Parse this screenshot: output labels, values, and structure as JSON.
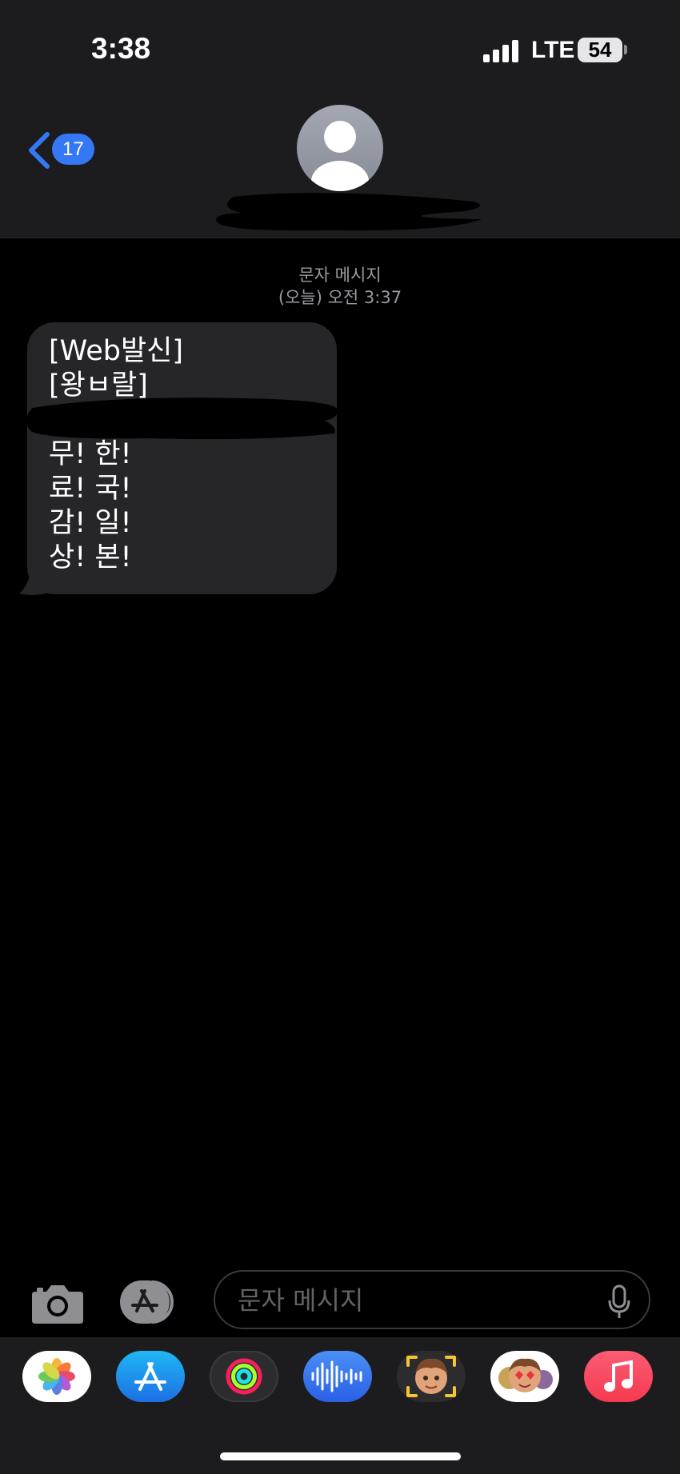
{
  "status_bar": {
    "time": "3:38",
    "network": "LTE",
    "battery": "54"
  },
  "header": {
    "back_count": "17"
  },
  "conversation": {
    "service_label": "문자 메시지",
    "timestamp": "(오늘) 오전 3:37",
    "message_text": "[Web발신]\n[왕ㅂ랄]\n\n무! 한!\n료! 국!\n감! 일!\n상! 본!"
  },
  "composer": {
    "placeholder": "문자 메시지"
  },
  "app_drawer": {
    "apps": [
      {
        "icon": "photos-icon"
      },
      {
        "icon": "app-store-icon"
      },
      {
        "icon": "activity-icon"
      },
      {
        "icon": "audio-message-icon"
      },
      {
        "icon": "memoji-camera-icon"
      },
      {
        "icon": "memoji-stickers-icon"
      },
      {
        "icon": "music-icon"
      }
    ]
  },
  "colors": {
    "accent": "#3478f6",
    "bubble": "#262628",
    "header": "#1c1c1e",
    "music_red": "#fa3f55"
  }
}
